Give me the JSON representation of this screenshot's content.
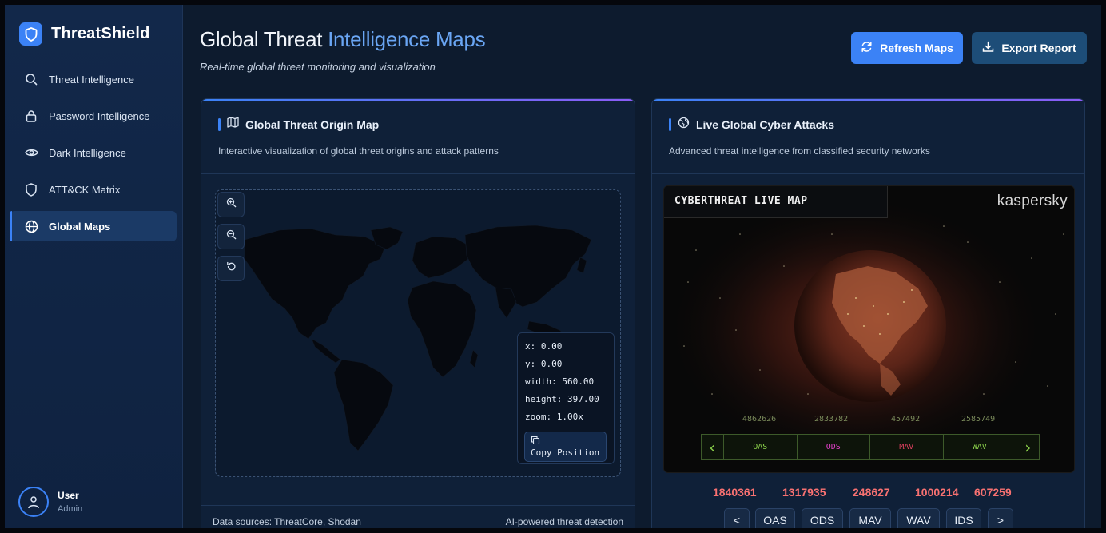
{
  "app": {
    "name": "ThreatShield",
    "logo_icon": "shield-icon"
  },
  "colors": {
    "accent": "#3b82f6",
    "sidebar_bg": "#12284a",
    "main_bg": "#0d1b2e",
    "panel_bg": "#0f2038",
    "stat_red": "#f87171"
  },
  "sidebar": {
    "items": [
      {
        "label": "Threat Intelligence",
        "icon": "search-icon",
        "active": false
      },
      {
        "label": "Password Intelligence",
        "icon": "lock-icon",
        "active": false
      },
      {
        "label": "Dark Intelligence",
        "icon": "eye-icon",
        "active": false
      },
      {
        "label": "ATT&CK Matrix",
        "icon": "shield-icon",
        "active": false
      },
      {
        "label": "Global Maps",
        "icon": "globe-icon",
        "active": true
      }
    ],
    "user": {
      "name": "User",
      "role": "Admin",
      "icon": "user-icon"
    }
  },
  "header": {
    "title_plain": "Global Threat ",
    "title_highlight": "Intelligence Maps",
    "subtitle": "Real-time global threat monitoring and visualization",
    "refresh_label": "Refresh Maps",
    "export_label": "Export Report"
  },
  "origin_panel": {
    "title": "Global Threat Origin Map",
    "description": "Interactive visualization of global threat origins and attack patterns",
    "position": {
      "x": "x: 0.00",
      "y": "y: 0.00",
      "width": "width: 560.00",
      "height": "height: 397.00",
      "zoom": "zoom: 1.00x",
      "copy_label": "Copy Position"
    },
    "sources": "Data sources: ThreatCore, Shodan",
    "ai_note": "AI-powered threat detection"
  },
  "attacks_panel": {
    "title": "Live Global Cyber Attacks",
    "description": "Advanced threat intelligence from classified security networks",
    "map_title": "CYBERTHREAT LIVE MAP",
    "map_brand": "kaspersky",
    "bar_numbers": [
      "4862626",
      "2833782",
      "457492",
      "2585749"
    ],
    "bar_cells": [
      {
        "label": "OAS",
        "color": "#8ad04a"
      },
      {
        "label": "ODS",
        "color": "#e040c8"
      },
      {
        "label": "MAV",
        "color": "#e04060"
      },
      {
        "label": "WAV",
        "color": "#8ad04a"
      }
    ],
    "stats": [
      "1840361",
      "1317935",
      "248627",
      "1000214",
      "607259"
    ],
    "prev_label": "<",
    "next_label": ">",
    "tabs": [
      "OAS",
      "ODS",
      "MAV",
      "WAV",
      "IDS"
    ]
  }
}
